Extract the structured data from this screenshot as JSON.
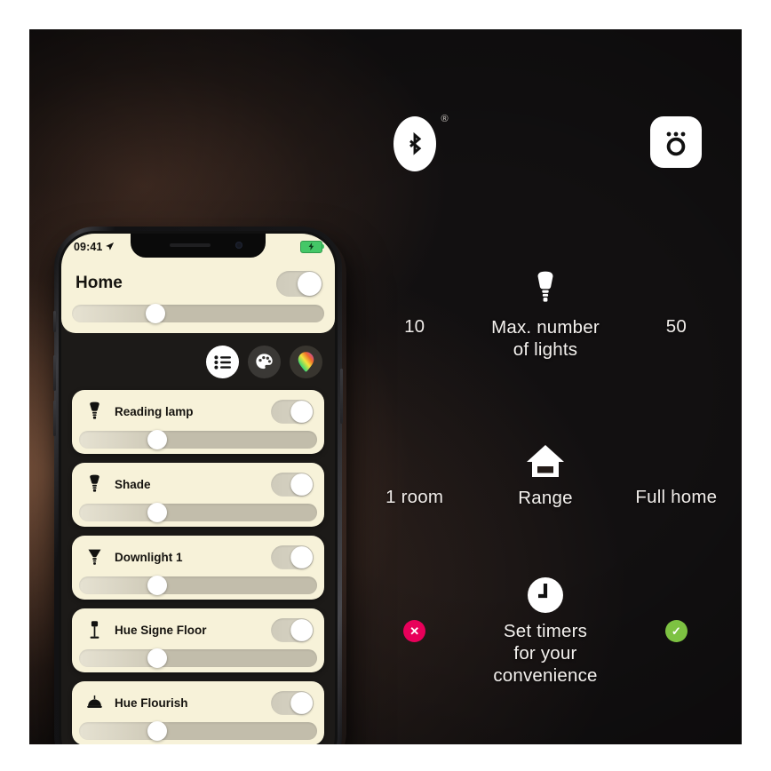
{
  "background": {
    "glow_color": "#ac7656",
    "base_color": "#121011"
  },
  "right_panel": {
    "logos": [
      {
        "name": "bluetooth",
        "icon": "bluetooth-icon",
        "trademark": "®"
      },
      {
        "name": "hue-bridge",
        "icon": "bridge-icon"
      }
    ],
    "comparison_rows": [
      {
        "id": "max-lights",
        "left_value": "10",
        "label": "Max. number\nof lights",
        "label_line1": "Max. number",
        "label_line2": "of lights",
        "right_value": "50",
        "icon": "bulb-icon"
      },
      {
        "id": "range",
        "left_value": "1 room",
        "label_line1": "Range",
        "label_line2": "",
        "right_value": "Full home",
        "icon": "house-icon"
      },
      {
        "id": "timers",
        "left_value": "",
        "left_badge": "✕",
        "left_badge_color": "#e8005a",
        "label_line1": "Set timers",
        "label_line2": "for your",
        "label_line3": "convenience",
        "right_value": "",
        "right_badge": "✓",
        "right_badge_color": "#7dc242",
        "icon": "clock-icon"
      }
    ]
  },
  "phone": {
    "status_bar": {
      "time": "09:41",
      "location_icon": "location-arrow-icon",
      "battery_icon": "battery-charging-icon",
      "battery_color": "#44c767"
    },
    "header": {
      "title": "Home",
      "master_toggle": {
        "state": "on",
        "icon": "toggle-icon"
      },
      "brightness_percent": 33
    },
    "tabs": [
      {
        "id": "list",
        "icon": "list-icon",
        "active": true
      },
      {
        "id": "scenes",
        "icon": "palette-icon",
        "active": false
      },
      {
        "id": "colors",
        "icon": "color-bulb-icon",
        "active": false
      }
    ],
    "lights": [
      {
        "name": "Reading lamp",
        "icon": "spot-bulb-icon",
        "toggle": "on",
        "brightness_percent": 33
      },
      {
        "name": "Shade",
        "icon": "spot-bulb-icon",
        "toggle": "on",
        "brightness_percent": 33
      },
      {
        "name": "Downlight 1",
        "icon": "downlight-icon",
        "toggle": "on",
        "brightness_percent": 33
      },
      {
        "name": "Hue Signe Floor",
        "icon": "floor-lamp-icon",
        "toggle": "on",
        "brightness_percent": 33
      },
      {
        "name": "Hue Flourish",
        "icon": "dome-lamp-icon",
        "toggle": "on",
        "brightness_percent": 33
      }
    ]
  }
}
